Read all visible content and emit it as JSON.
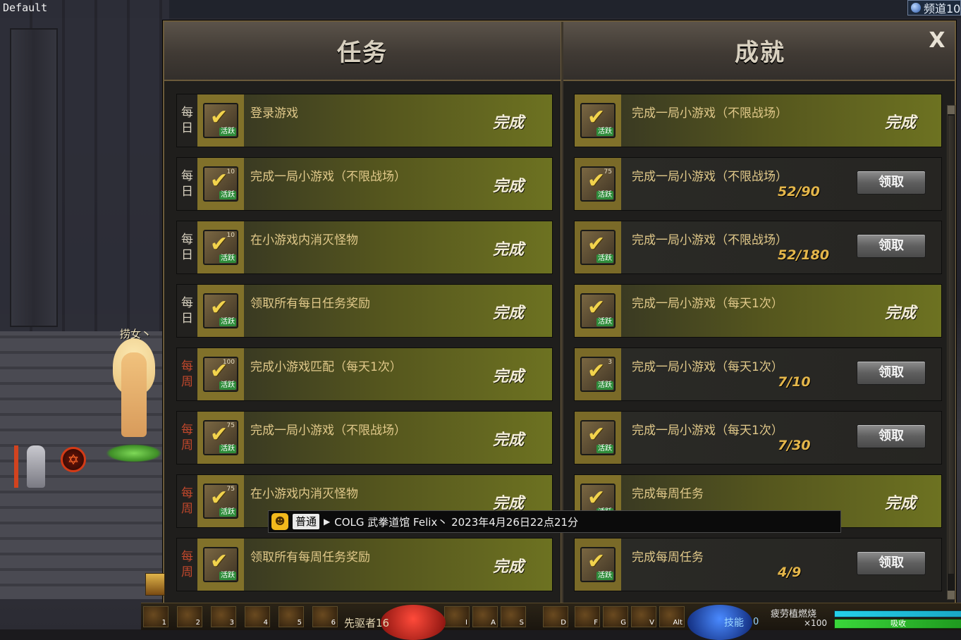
{
  "header": {
    "default_label": "Default",
    "channel": "频道10"
  },
  "scene": {
    "character_name": "捞女丶"
  },
  "window": {
    "quest_tab": "任务",
    "achievement_tab": "成就",
    "close_label": "X"
  },
  "quests": [
    {
      "period": [
        "每",
        "日"
      ],
      "weekly": false,
      "title": "登录游戏",
      "status": "完成",
      "icon_level": ""
    },
    {
      "period": [
        "每",
        "日"
      ],
      "weekly": false,
      "title": "完成一局小游戏（不限战场）",
      "status": "完成",
      "icon_level": "10"
    },
    {
      "period": [
        "每",
        "日"
      ],
      "weekly": false,
      "title": "在小游戏内消灭怪物",
      "status": "完成",
      "icon_level": "10"
    },
    {
      "period": [
        "每",
        "日"
      ],
      "weekly": false,
      "title": "领取所有每日任务奖励",
      "status": "完成",
      "icon_level": ""
    },
    {
      "period": [
        "每",
        "周"
      ],
      "weekly": true,
      "title": "完成小游戏匹配（每天1次）",
      "status": "完成",
      "icon_level": "100"
    },
    {
      "period": [
        "每",
        "周"
      ],
      "weekly": true,
      "title": "完成一局小游戏（不限战场）",
      "status": "完成",
      "icon_level": "75"
    },
    {
      "period": [
        "每",
        "周"
      ],
      "weekly": true,
      "title": "在小游戏内消灭怪物",
      "status": "完成",
      "icon_level": "75"
    },
    {
      "period": [
        "每",
        "周"
      ],
      "weekly": true,
      "title": "领取所有每周任务奖励",
      "status": "完成",
      "icon_level": ""
    }
  ],
  "icon_badge": "活跃",
  "achievements": [
    {
      "title": "完成一局小游戏（不限战场）",
      "state": "done",
      "status": "完成",
      "progress": "",
      "icon_level": ""
    },
    {
      "title": "完成一局小游戏（不限战场）",
      "state": "progress",
      "status": "",
      "progress": "52/90",
      "button": "领取",
      "icon_level": "75"
    },
    {
      "title": "完成一局小游戏（不限战场）",
      "state": "progress",
      "status": "",
      "progress": "52/180",
      "button": "领取",
      "icon_level": ""
    },
    {
      "title": "完成一局小游戏（每天1次）",
      "state": "done",
      "status": "完成",
      "progress": "",
      "icon_level": ""
    },
    {
      "title": "完成一局小游戏（每天1次）",
      "state": "progress",
      "status": "",
      "progress": "7/10",
      "button": "领取",
      "icon_level": "3"
    },
    {
      "title": "完成一局小游戏（每天1次）",
      "state": "progress",
      "status": "",
      "progress": "7/30",
      "button": "领取",
      "icon_level": ""
    },
    {
      "title": "完成每周任务",
      "state": "done",
      "status": "完成",
      "progress": "",
      "icon_level": ""
    },
    {
      "title": "完成每周任务",
      "state": "progress",
      "status": "",
      "progress": "4/9",
      "button": "领取",
      "icon_level": ""
    }
  ],
  "chat": {
    "channel": "普通",
    "message": "COLG 武拳道馆 Felix丶 2023年4月26日22点21分"
  },
  "hotbar": {
    "class_label": "先驱者16",
    "skill_label": "技能",
    "skill_count": "0",
    "fatigue_label": "疲劳植燃烧",
    "fatigue_count": "×100",
    "fatigue_bar_label": "吸收",
    "keys": [
      "1",
      "2",
      "3",
      "4",
      "5",
      "6",
      "I",
      "A",
      "S",
      "D",
      "F",
      "G",
      "V",
      "Alt"
    ]
  }
}
